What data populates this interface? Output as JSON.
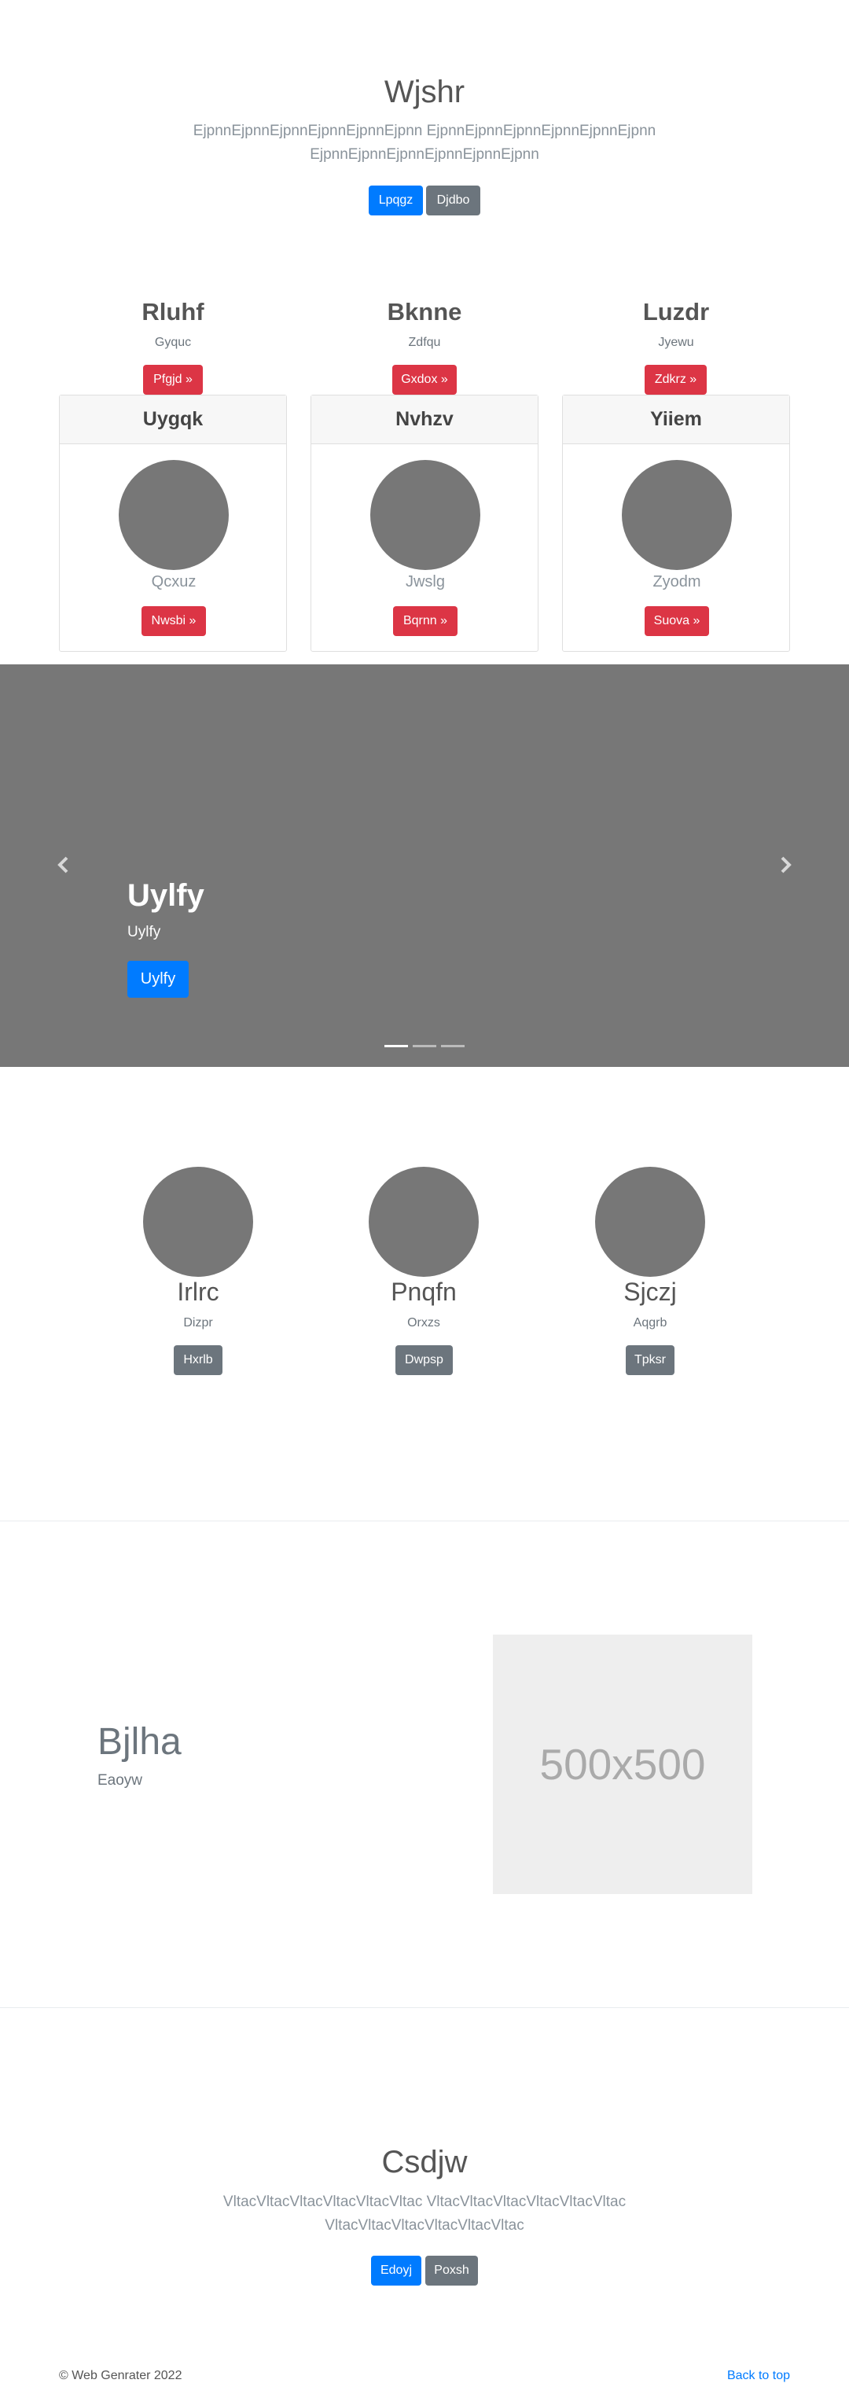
{
  "jumbotron": {
    "title": "Wjshr",
    "text_line1": "EjpnnEjpnnEjpnnEjpnnEjpnnEjpnn EjpnnEjpnnEjpnnEjpnnEjpnnEjpnn",
    "text_line2": "EjpnnEjpnnEjpnnEjpnnEjpnnEjpnn",
    "primary_button": "Lpqgz",
    "secondary_button": "Djdbo"
  },
  "columns": [
    {
      "heading": "Rluhf",
      "text": "Gyquc",
      "button": "Pfgjd »"
    },
    {
      "heading": "Bknne",
      "text": "Zdfqu",
      "button": "Gxdox »"
    },
    {
      "heading": "Luzdr",
      "text": "Jyewu",
      "button": "Zdkrz »"
    }
  ],
  "cards": [
    {
      "header": "Uygqk",
      "caption": "Qcxuz",
      "button": "Nwsbi »"
    },
    {
      "header": "Nvhzv",
      "caption": "Jwslg",
      "button": "Bqrnn »"
    },
    {
      "header": "Yiiem",
      "caption": "Zyodm",
      "button": "Suova »"
    }
  ],
  "carousel": {
    "heading": "Uylfy",
    "text": "Uylfy",
    "button": "Uylfy",
    "prev_icon": "chevron-left-icon",
    "next_icon": "chevron-right-icon",
    "active_indicator": 1,
    "indicator_count": 3,
    "background_color": "#777777"
  },
  "marketing": [
    {
      "heading": "Irlrc",
      "text": "Dizpr",
      "button": "Hxrlb"
    },
    {
      "heading": "Pnqfn",
      "text": "Orxzs",
      "button": "Dwpsp"
    },
    {
      "heading": "Sjczj",
      "text": "Aqgrb",
      "button": "Tpksr"
    }
  ],
  "featurette": {
    "heading": "Bjlha",
    "text": "Eaoyw",
    "image_label": "500x500"
  },
  "bottom_section": {
    "title": "Csdjw",
    "text_line1": "VltacVltacVltacVltacVltacVltac VltacVltacVltacVltacVltacVltac",
    "text_line2": "VltacVltacVltacVltacVltacVltac",
    "primary_button": "Edoyj",
    "secondary_button": "Poxsh"
  },
  "footer": {
    "copyright": "© Web Genrater 2022",
    "back_to_top": "Back to top"
  },
  "colors": {
    "primary": "#007bff",
    "secondary": "#6c757d",
    "danger": "#dc3545",
    "placeholder_gray": "#777777"
  }
}
